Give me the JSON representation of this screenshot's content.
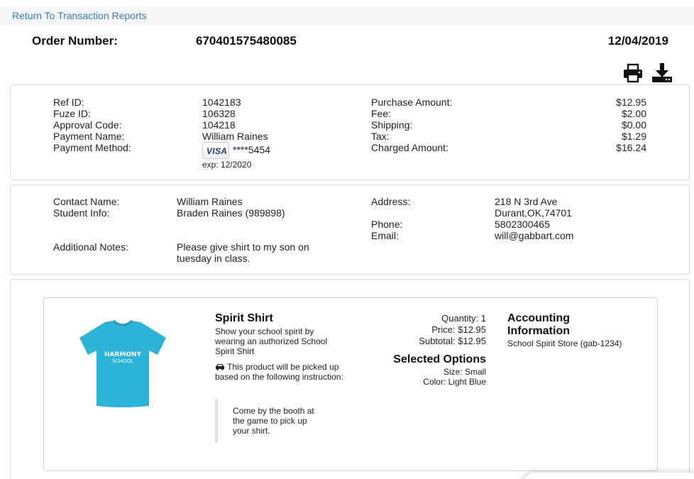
{
  "header": {
    "back_link": "Return To Transaction Reports",
    "order_label": "Order Number:",
    "order_number": "670401575480085",
    "order_date": "12/04/2019"
  },
  "toolbar": {
    "print_icon": "printer-icon",
    "download_icon": "download-icon"
  },
  "payment": {
    "ref_id_label": "Ref ID:",
    "ref_id": "1042183",
    "fuze_id_label": "Fuze ID:",
    "fuze_id": "106328",
    "approval_code_label": "Approval Code:",
    "approval_code": "104218",
    "payment_name_label": "Payment Name:",
    "payment_name": "William Raines",
    "payment_method_label": "Payment Method:",
    "card_brand": "VISA",
    "card_masked": "****5454",
    "card_exp": "exp: 12/2020"
  },
  "amounts": {
    "purchase_label": "Purchase Amount:",
    "purchase": "$12.95",
    "fee_label": "Fee:",
    "fee": "$2.00",
    "shipping_label": "Shipping:",
    "shipping": "$0.00",
    "tax_label": "Tax:",
    "tax": "$1.29",
    "charged_label": "Charged Amount:",
    "charged": "$16.24"
  },
  "contact": {
    "contact_name_label": "Contact Name:",
    "contact_name": "William Raines",
    "student_info_label": "Student Info:",
    "student_info": "Braden Raines (989898)",
    "notes_label": "Additional Notes:",
    "notes_line1": "Please give shirt to my son on",
    "notes_line2": "tuesday in class.",
    "address_label": "Address:",
    "address_line1": "218 N 3rd Ave",
    "address_line2": "Durant,OK,74701",
    "phone_label": "Phone:",
    "phone": "5802300465",
    "email_label": "Email:",
    "email": "will@gabbart.com"
  },
  "product": {
    "shirt_text_line1": "HARMONY",
    "shirt_text_line2": "SCHOOL",
    "shirt_color": "#2bb3d8",
    "title": "Spirit Shirt",
    "description": "Show your school spirit by wearing an authorized School Spirit Shirt",
    "pickup_note": "This product will be picked up based on the following instruction:",
    "pickup_instruction": "Come by the booth at the game to pick up your shirt.",
    "quantity": "Quantity: 1",
    "price": "Price: $12.95",
    "subtotal": "Subtotal: $12.95",
    "options_title": "Selected Options",
    "option_size": "Size: Small",
    "option_color": "Color: Light Blue",
    "accounting_title": "Accounting Information",
    "accounting_value": "School Spirit Store (gab-1234)"
  },
  "colors": {
    "link": "#3b7ab8",
    "border": "#d8d8d8"
  }
}
